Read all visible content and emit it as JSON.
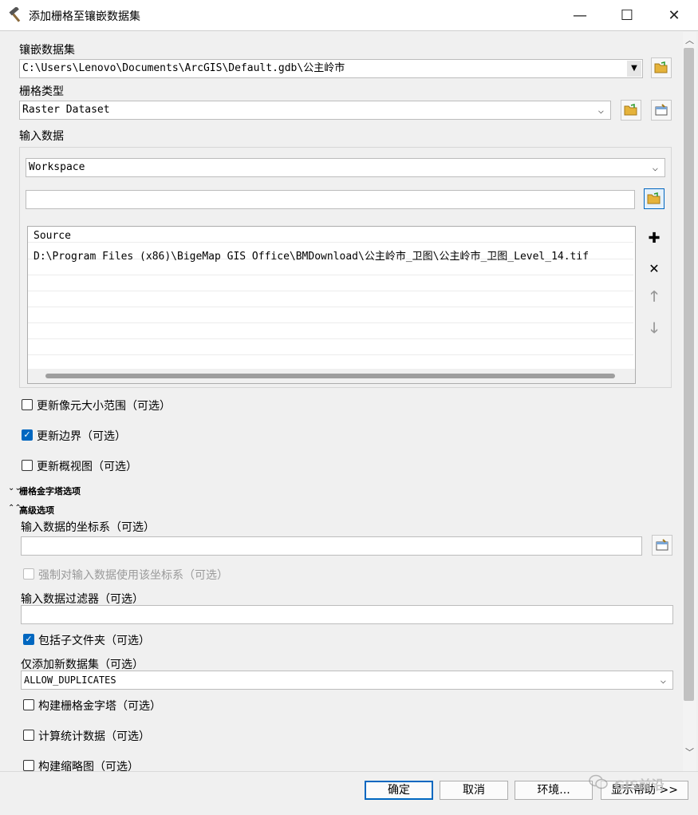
{
  "window": {
    "title": "添加栅格至镶嵌数据集",
    "icon": "hammer-icon",
    "minimize": "—",
    "maximize": "☐",
    "close": "✕"
  },
  "mosaic": {
    "label": "镶嵌数据集",
    "value": "C:\\Users\\Lenovo\\Documents\\ArcGIS\\Default.gdb\\公主岭市"
  },
  "raster_type": {
    "label": "栅格类型",
    "value": "Raster Dataset"
  },
  "input": {
    "label": "输入数据",
    "type_value": "Workspace",
    "path_value": "",
    "list_header": "Source",
    "list_items": [
      "D:\\Program Files (x86)\\BigeMap GIS Office\\BMDownload\\公主岭市_卫图\\公主岭市_卫图_Level_14.tif"
    ]
  },
  "options": {
    "update_cellsize": {
      "label": "更新像元大小范围（可选）",
      "checked": false
    },
    "update_boundary": {
      "label": "更新边界（可选）",
      "checked": true
    },
    "update_overviews": {
      "label": "更新概视图（可选）",
      "checked": false
    }
  },
  "sections": {
    "pyramid": "栅格金字塔选项",
    "advanced": "高级选项"
  },
  "advanced": {
    "coord_label": "输入数据的坐标系（可选）",
    "coord_value": "",
    "force_label": "强制对输入数据使用该坐标系（可选）",
    "filter_label": "输入数据过滤器（可选）",
    "filter_value": "",
    "subfolders_label": "包括子文件夹（可选）",
    "new_only_label": "仅添加新数据集（可选）",
    "new_only_value": "ALLOW_DUPLICATES",
    "build_pyramids_label": "构建栅格金字塔（可选）",
    "calc_stats_label": "计算统计数据（可选）",
    "build_thumbs_label": "构建缩略图（可选）"
  },
  "footer": {
    "ok": "确定",
    "cancel": "取消",
    "env": "环境...",
    "help": "显示帮助 >>"
  },
  "watermark": "GIS前沿",
  "colors": {
    "accent": "#0067c0",
    "folder": "#e5b33b"
  }
}
